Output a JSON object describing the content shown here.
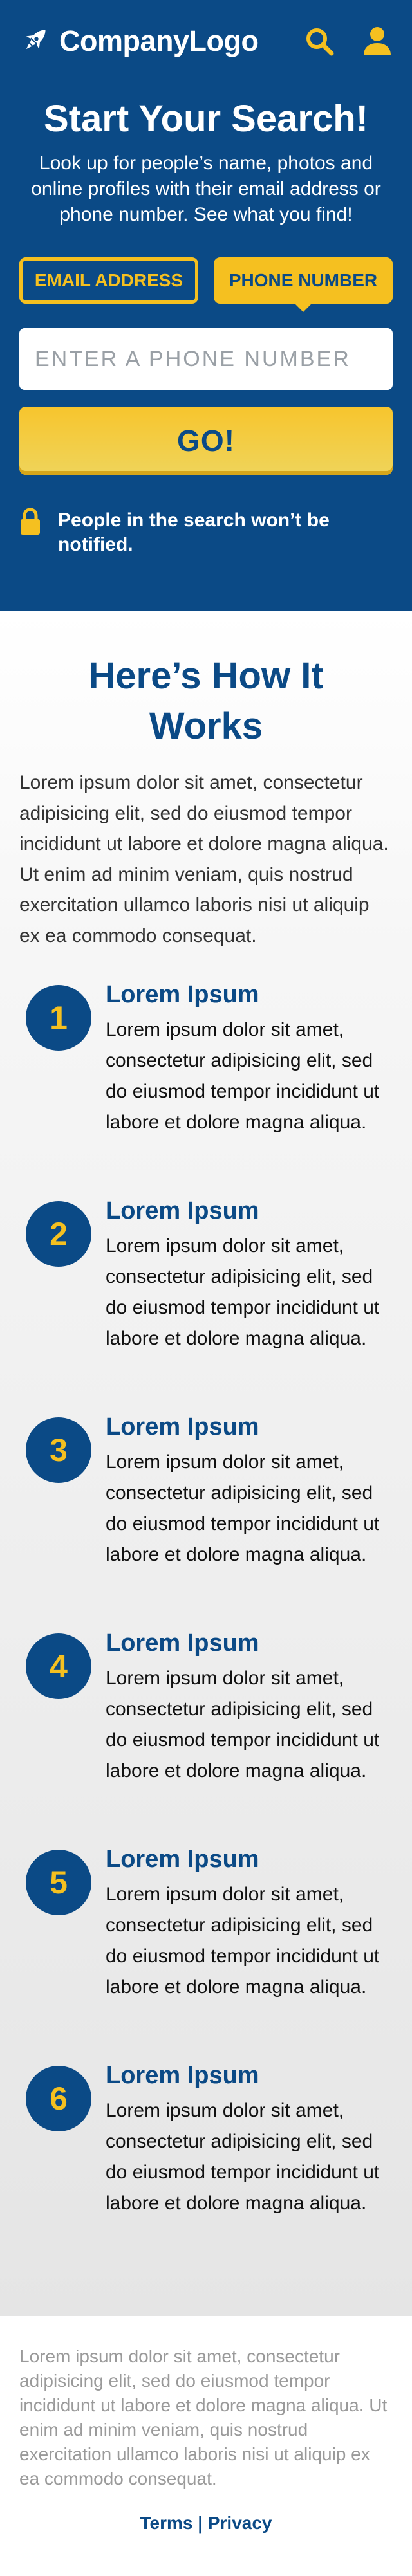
{
  "header": {
    "logo_text": "CompanyLogo",
    "logo_icon": "rocket-icon",
    "search_icon": "search-icon",
    "account_icon": "user-icon"
  },
  "hero": {
    "title": "Start Your Search!",
    "subtitle": "Look up for people’s name, photos and online profiles with their email address or phone number. See what you find!",
    "tabs": [
      {
        "label": "EMAIL ADDRESS",
        "active": false
      },
      {
        "label": "PHONE NUMBER",
        "active": true
      }
    ],
    "input_placeholder": "ENTER A PHONE NUMBER",
    "go_label": "GO!",
    "notice_icon": "lock-icon",
    "notice": "People in the search won’t be notified."
  },
  "how": {
    "title_line1": "Here’s How It",
    "title_line2": "Works",
    "intro": "Lorem ipsum dolor sit amet, consectetur adipisicing elit, sed do eiusmod tempor incididunt ut labore et dolore magna aliqua. Ut enim ad minim veniam, quis nostrud exercitation ullamco laboris nisi ut aliquip ex ea commodo consequat.",
    "steps": [
      {
        "num": "1",
        "title": "Lorem Ipsum",
        "text": "Lorem ipsum dolor sit amet, consectetur adipisicing elit, sed do eiusmod tempor incididunt ut labore et dolore magna aliqua."
      },
      {
        "num": "2",
        "title": "Lorem Ipsum",
        "text": "Lorem ipsum dolor sit amet, consectetur adipisicing elit, sed do eiusmod tempor incididunt ut labore et dolore magna aliqua."
      },
      {
        "num": "3",
        "title": "Lorem Ipsum",
        "text": "Lorem ipsum dolor sit amet, consectetur adipisicing elit, sed do eiusmod tempor incididunt ut labore et dolore magna aliqua."
      },
      {
        "num": "4",
        "title": "Lorem Ipsum",
        "text": "Lorem ipsum dolor sit amet, consectetur adipisicing elit, sed do eiusmod tempor incididunt ut labore et dolore magna aliqua."
      },
      {
        "num": "5",
        "title": "Lorem Ipsum",
        "text": "Lorem ipsum dolor sit amet, consectetur adipisicing elit, sed do eiusmod tempor incididunt ut labore et dolore magna aliqua."
      },
      {
        "num": "6",
        "title": "Lorem Ipsum",
        "text": "Lorem ipsum dolor sit amet, consectetur adipisicing elit, sed do eiusmod tempor incididunt ut labore et dolore magna aliqua."
      }
    ]
  },
  "footer": {
    "text": "Lorem ipsum dolor sit amet, consectetur adipisicing elit, sed do eiusmod tempor incididunt ut labore et dolore magna aliqua. Ut enim ad minim veniam, quis nostrud exercitation ullamco laboris nisi ut aliquip ex ea commodo consequat.",
    "terms_label": "Terms",
    "separator": "|",
    "privacy_label": "Privacy"
  },
  "colors": {
    "brand_blue": "#0b4a86",
    "accent_yellow": "#f5c020"
  }
}
